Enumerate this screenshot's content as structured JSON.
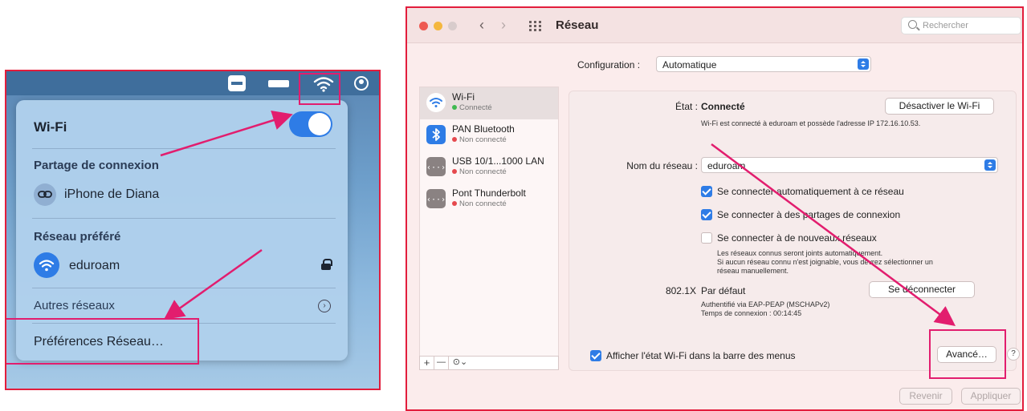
{
  "left": {
    "wifi_title": "Wi-Fi",
    "hotspot_heading": "Partage de connexion",
    "hotspot_name": "iPhone de Diana",
    "preferred_heading": "Réseau préféré",
    "preferred_network": "eduroam",
    "other_networks": "Autres réseaux",
    "preferences_link": "Préférences Réseau…",
    "wifi_enabled": true
  },
  "window": {
    "title": "Réseau",
    "search_placeholder": "Rechercher",
    "back_glyph": "‹",
    "forward_glyph": "›"
  },
  "config": {
    "label": "Configuration :",
    "value": "Automatique"
  },
  "services": [
    {
      "name": "Wi-Fi",
      "status": "Connecté",
      "icon": "wifi-icon",
      "status_color": "#3fb950"
    },
    {
      "name": "PAN Bluetooth",
      "status": "Non connecté",
      "icon": "bluetooth-icon",
      "status_color": "#e5484d"
    },
    {
      "name": "USB 10/1...1000 LAN",
      "status": "Non connecté",
      "icon": "ethernet-icon",
      "status_color": "#e5484d"
    },
    {
      "name": "Pont Thunderbolt",
      "status": "Non connecté",
      "icon": "ethernet-icon",
      "status_color": "#e5484d"
    }
  ],
  "service_controls": {
    "add": "+",
    "remove": "—",
    "more": "⊙⌄"
  },
  "detail": {
    "state_label": "État :",
    "state_value": "Connecté",
    "deactivate_button": "Désactiver le Wi-Fi",
    "state_description": "Wi-Fi est connecté à eduroam et possède l'adresse IP 172.16.10.53.",
    "network_name_label": "Nom du réseau :",
    "network_name_value": "eduroam",
    "auto_join_label": "Se connecter automatiquement à ce réseau",
    "auto_join_checked": true,
    "hotspot_join_label": "Se connecter à des partages de connexion",
    "hotspot_join_checked": true,
    "ask_new_label": "Se connecter à de nouveaux réseaux",
    "ask_new_checked": false,
    "ask_new_note_1": "Les réseaux connus seront joints automatiquement.",
    "ask_new_note_2": "Si aucun réseau connu n'est joignable, vous devrez sélectionner un",
    "ask_new_note_3": "réseau manuellement.",
    "dot1x_label": "802.1X",
    "dot1x_value": "Par défaut",
    "disconnect_button": "Se déconnecter",
    "auth_info": "Authentifié via EAP-PEAP (MSCHAPv2)",
    "connection_time": "Temps de connexion : 00:14:45",
    "show_status_label": "Afficher l'état Wi-Fi dans la barre des menus",
    "show_status_checked": true,
    "advanced_button": "Avancé…",
    "help_glyph": "?"
  },
  "footer": {
    "revert_button": "Revenir",
    "apply_button": "Appliquer"
  },
  "colors": {
    "annotation": "#e21d6e",
    "accent_blue": "#2e7ce6",
    "panel_border": "#e21d3c"
  }
}
